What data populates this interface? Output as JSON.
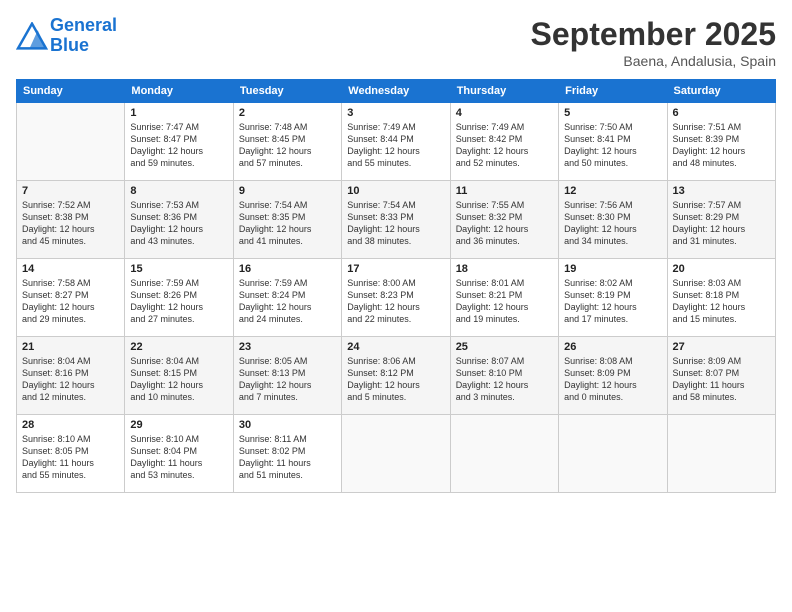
{
  "header": {
    "logo_line1": "General",
    "logo_line2": "Blue",
    "month": "September 2025",
    "location": "Baena, Andalusia, Spain"
  },
  "weekdays": [
    "Sunday",
    "Monday",
    "Tuesday",
    "Wednesday",
    "Thursday",
    "Friday",
    "Saturday"
  ],
  "weeks": [
    [
      {
        "day": "",
        "info": ""
      },
      {
        "day": "1",
        "info": "Sunrise: 7:47 AM\nSunset: 8:47 PM\nDaylight: 12 hours\nand 59 minutes."
      },
      {
        "day": "2",
        "info": "Sunrise: 7:48 AM\nSunset: 8:45 PM\nDaylight: 12 hours\nand 57 minutes."
      },
      {
        "day": "3",
        "info": "Sunrise: 7:49 AM\nSunset: 8:44 PM\nDaylight: 12 hours\nand 55 minutes."
      },
      {
        "day": "4",
        "info": "Sunrise: 7:49 AM\nSunset: 8:42 PM\nDaylight: 12 hours\nand 52 minutes."
      },
      {
        "day": "5",
        "info": "Sunrise: 7:50 AM\nSunset: 8:41 PM\nDaylight: 12 hours\nand 50 minutes."
      },
      {
        "day": "6",
        "info": "Sunrise: 7:51 AM\nSunset: 8:39 PM\nDaylight: 12 hours\nand 48 minutes."
      }
    ],
    [
      {
        "day": "7",
        "info": "Sunrise: 7:52 AM\nSunset: 8:38 PM\nDaylight: 12 hours\nand 45 minutes."
      },
      {
        "day": "8",
        "info": "Sunrise: 7:53 AM\nSunset: 8:36 PM\nDaylight: 12 hours\nand 43 minutes."
      },
      {
        "day": "9",
        "info": "Sunrise: 7:54 AM\nSunset: 8:35 PM\nDaylight: 12 hours\nand 41 minutes."
      },
      {
        "day": "10",
        "info": "Sunrise: 7:54 AM\nSunset: 8:33 PM\nDaylight: 12 hours\nand 38 minutes."
      },
      {
        "day": "11",
        "info": "Sunrise: 7:55 AM\nSunset: 8:32 PM\nDaylight: 12 hours\nand 36 minutes."
      },
      {
        "day": "12",
        "info": "Sunrise: 7:56 AM\nSunset: 8:30 PM\nDaylight: 12 hours\nand 34 minutes."
      },
      {
        "day": "13",
        "info": "Sunrise: 7:57 AM\nSunset: 8:29 PM\nDaylight: 12 hours\nand 31 minutes."
      }
    ],
    [
      {
        "day": "14",
        "info": "Sunrise: 7:58 AM\nSunset: 8:27 PM\nDaylight: 12 hours\nand 29 minutes."
      },
      {
        "day": "15",
        "info": "Sunrise: 7:59 AM\nSunset: 8:26 PM\nDaylight: 12 hours\nand 27 minutes."
      },
      {
        "day": "16",
        "info": "Sunrise: 7:59 AM\nSunset: 8:24 PM\nDaylight: 12 hours\nand 24 minutes."
      },
      {
        "day": "17",
        "info": "Sunrise: 8:00 AM\nSunset: 8:23 PM\nDaylight: 12 hours\nand 22 minutes."
      },
      {
        "day": "18",
        "info": "Sunrise: 8:01 AM\nSunset: 8:21 PM\nDaylight: 12 hours\nand 19 minutes."
      },
      {
        "day": "19",
        "info": "Sunrise: 8:02 AM\nSunset: 8:19 PM\nDaylight: 12 hours\nand 17 minutes."
      },
      {
        "day": "20",
        "info": "Sunrise: 8:03 AM\nSunset: 8:18 PM\nDaylight: 12 hours\nand 15 minutes."
      }
    ],
    [
      {
        "day": "21",
        "info": "Sunrise: 8:04 AM\nSunset: 8:16 PM\nDaylight: 12 hours\nand 12 minutes."
      },
      {
        "day": "22",
        "info": "Sunrise: 8:04 AM\nSunset: 8:15 PM\nDaylight: 12 hours\nand 10 minutes."
      },
      {
        "day": "23",
        "info": "Sunrise: 8:05 AM\nSunset: 8:13 PM\nDaylight: 12 hours\nand 7 minutes."
      },
      {
        "day": "24",
        "info": "Sunrise: 8:06 AM\nSunset: 8:12 PM\nDaylight: 12 hours\nand 5 minutes."
      },
      {
        "day": "25",
        "info": "Sunrise: 8:07 AM\nSunset: 8:10 PM\nDaylight: 12 hours\nand 3 minutes."
      },
      {
        "day": "26",
        "info": "Sunrise: 8:08 AM\nSunset: 8:09 PM\nDaylight: 12 hours\nand 0 minutes."
      },
      {
        "day": "27",
        "info": "Sunrise: 8:09 AM\nSunset: 8:07 PM\nDaylight: 11 hours\nand 58 minutes."
      }
    ],
    [
      {
        "day": "28",
        "info": "Sunrise: 8:10 AM\nSunset: 8:05 PM\nDaylight: 11 hours\nand 55 minutes."
      },
      {
        "day": "29",
        "info": "Sunrise: 8:10 AM\nSunset: 8:04 PM\nDaylight: 11 hours\nand 53 minutes."
      },
      {
        "day": "30",
        "info": "Sunrise: 8:11 AM\nSunset: 8:02 PM\nDaylight: 11 hours\nand 51 minutes."
      },
      {
        "day": "",
        "info": ""
      },
      {
        "day": "",
        "info": ""
      },
      {
        "day": "",
        "info": ""
      },
      {
        "day": "",
        "info": ""
      }
    ]
  ]
}
